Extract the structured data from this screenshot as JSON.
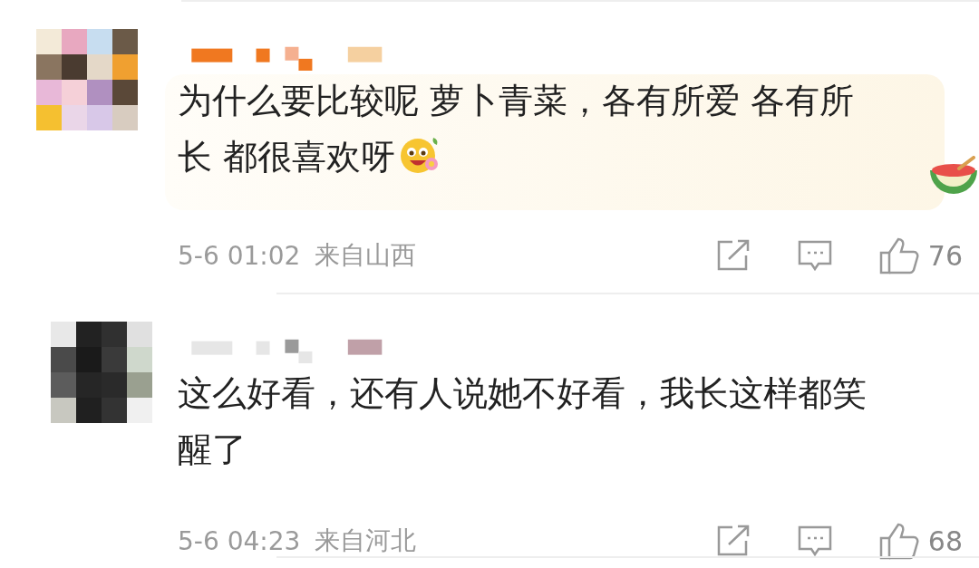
{
  "comments": [
    {
      "text": "为什么要比较呢 萝卜青菜，各有所爱 各有所长 都很喜欢呀",
      "emoji": true,
      "decorated": true,
      "time": "5-6 01:02",
      "location": "来自山西",
      "likes": "76"
    },
    {
      "text": "这么好看，还有人说她不好看，我长这样都笑醒了",
      "emoji": false,
      "decorated": false,
      "time": "5-6 04:23",
      "location": "来自河北",
      "likes": "68"
    }
  ]
}
